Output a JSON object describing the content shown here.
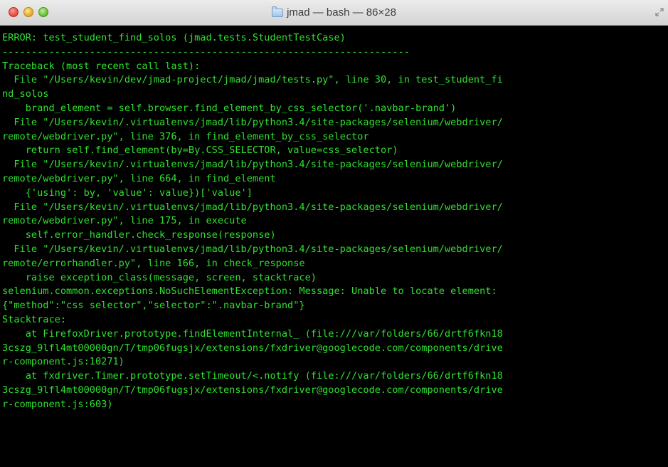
{
  "window": {
    "title": "jmad — bash — 86×28"
  },
  "colors": {
    "terminal_background": "#000000",
    "terminal_text": "#30e030"
  },
  "terminal": {
    "lines": [
      "ERROR: test_student_find_solos (jmad.tests.StudentTestCase)",
      "----------------------------------------------------------------------",
      "Traceback (most recent call last):",
      "  File \"/Users/kevin/dev/jmad-project/jmad/jmad/tests.py\", line 30, in test_student_fi",
      "nd_solos",
      "    brand_element = self.browser.find_element_by_css_selector('.navbar-brand')",
      "  File \"/Users/kevin/.virtualenvs/jmad/lib/python3.4/site-packages/selenium/webdriver/",
      "remote/webdriver.py\", line 376, in find_element_by_css_selector",
      "    return self.find_element(by=By.CSS_SELECTOR, value=css_selector)",
      "  File \"/Users/kevin/.virtualenvs/jmad/lib/python3.4/site-packages/selenium/webdriver/",
      "remote/webdriver.py\", line 664, in find_element",
      "    {'using': by, 'value': value})['value']",
      "  File \"/Users/kevin/.virtualenvs/jmad/lib/python3.4/site-packages/selenium/webdriver/",
      "remote/webdriver.py\", line 175, in execute",
      "    self.error_handler.check_response(response)",
      "  File \"/Users/kevin/.virtualenvs/jmad/lib/python3.4/site-packages/selenium/webdriver/",
      "remote/errorhandler.py\", line 166, in check_response",
      "    raise exception_class(message, screen, stacktrace)",
      "selenium.common.exceptions.NoSuchElementException: Message: Unable to locate element:",
      "{\"method\":\"css selector\",\"selector\":\".navbar-brand\"}",
      "Stacktrace:",
      "    at FirefoxDriver.prototype.findElementInternal_ (file:///var/folders/66/drtf6fkn18",
      "3cszg_9lfl4mt00000gn/T/tmp06fugsjx/extensions/fxdriver@googlecode.com/components/drive",
      "r-component.js:10271)",
      "    at fxdriver.Timer.prototype.setTimeout/<.notify (file:///var/folders/66/drtf6fkn18",
      "3cszg_9lfl4mt00000gn/T/tmp06fugsjx/extensions/fxdriver@googlecode.com/components/drive",
      "r-component.js:603)"
    ]
  }
}
